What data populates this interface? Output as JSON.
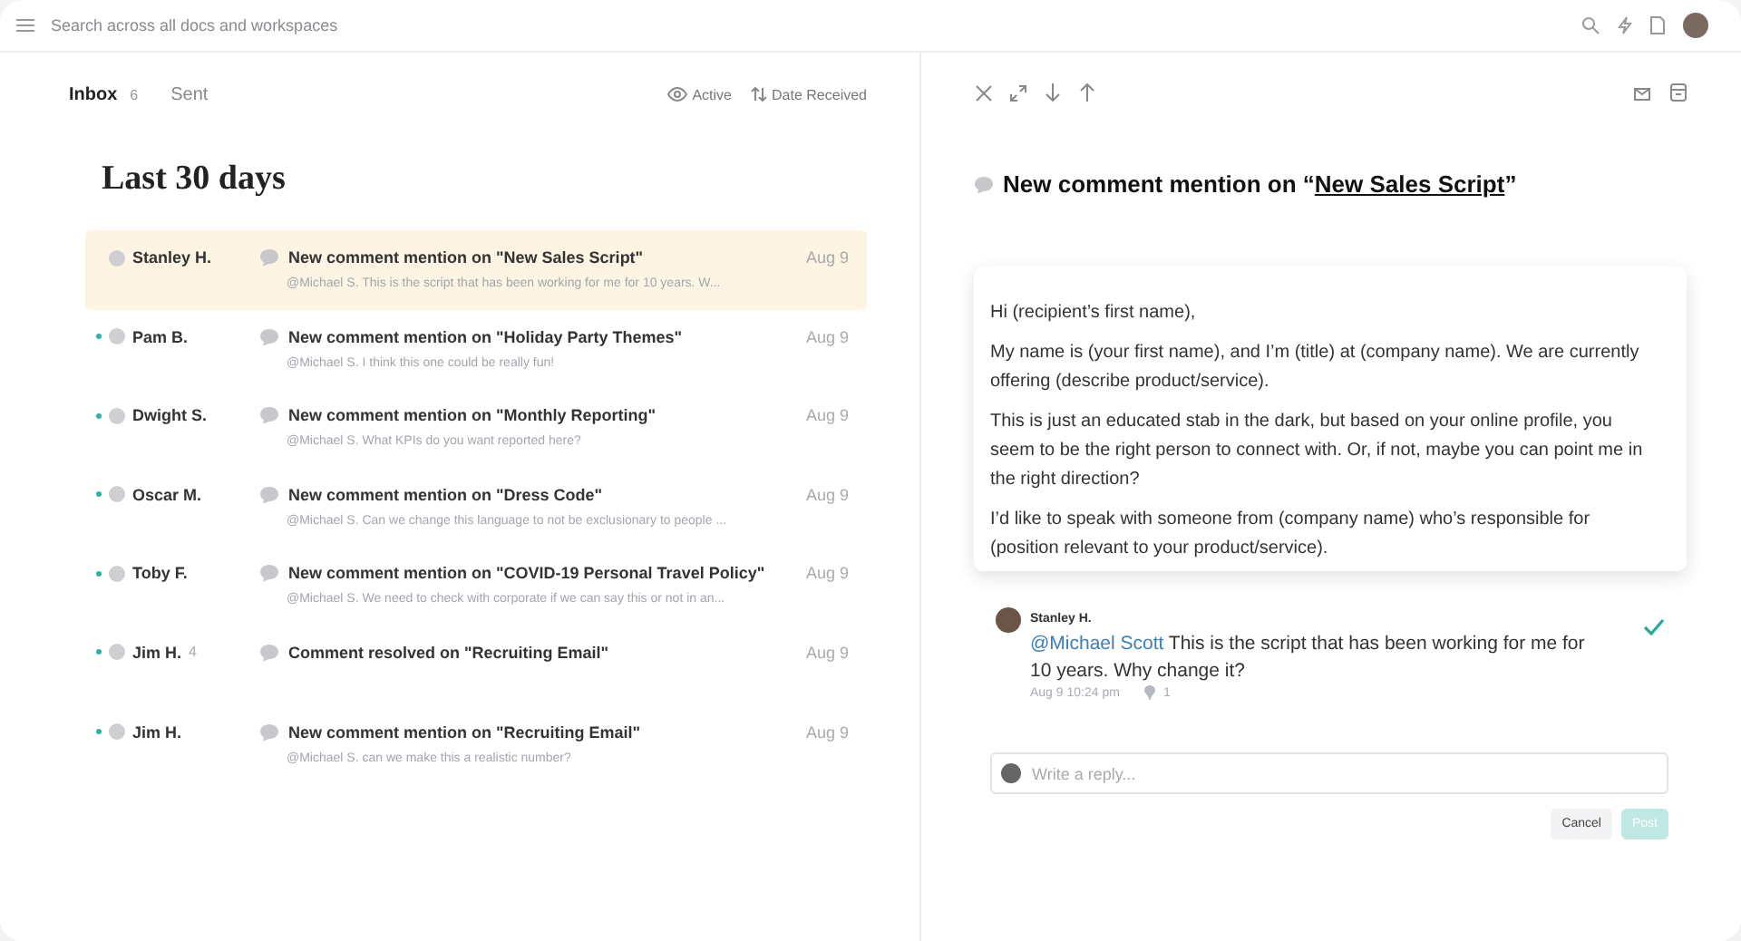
{
  "search": {
    "placeholder": "Search across all docs and workspaces"
  },
  "tabs": [
    {
      "label": "Inbox",
      "count": "6",
      "selected": true
    },
    {
      "label": "Sent",
      "selected": false
    }
  ],
  "filters": [
    {
      "kind": "view",
      "label": "Active"
    },
    {
      "kind": "sort",
      "label": "Date Received"
    }
  ],
  "section_title": "Last 30 days",
  "notifications": [
    {
      "sender": "Stanley H.",
      "unread": false,
      "selected": true,
      "title": "New comment mention on \"New Sales Script\"",
      "preview": "@Michael S. This is the script that has been working for me for 10 years. W...",
      "date": "Aug 9"
    },
    {
      "sender": "Pam B.",
      "unread": true,
      "selected": false,
      "title": "New comment mention on \"Holiday Party Themes\"",
      "preview": "@Michael S. I think this one could be really fun!",
      "date": "Aug 9"
    },
    {
      "sender": "Dwight S.",
      "unread": true,
      "selected": false,
      "title": "New comment mention on \"Monthly Reporting\"",
      "preview": "@Michael S. What KPIs do you want reported here?",
      "date": "Aug 9"
    },
    {
      "sender": "Oscar M.",
      "unread": true,
      "selected": false,
      "title": "New comment mention on \"Dress Code\"",
      "preview": "@Michael S. Can we change this language to not be exclusionary to people ...",
      "date": "Aug 9"
    },
    {
      "sender": "Toby F.",
      "unread": true,
      "selected": false,
      "title": "New comment mention on \"COVID-19 Personal Travel Policy\"",
      "preview": "@Michael S. We need to check with corporate if we can say this or not in an...",
      "date": "Aug 9"
    },
    {
      "sender": "Jim H.",
      "count": "4",
      "unread": true,
      "selected": false,
      "title": "Comment resolved on \"Recruiting Email\"",
      "date": "Aug 9"
    },
    {
      "sender": "Jim H.",
      "unread": true,
      "selected": false,
      "title": "New comment mention on \"Recruiting Email\"",
      "preview": "@Michael S. can we make this a realistic number?",
      "date": "Aug 9"
    }
  ],
  "detail": {
    "title_prefix": "New comment mention on “",
    "doc_link": "New Sales Script",
    "title_suffix": "”",
    "document_paragraphs": [
      "Hi (recipient’s first name),",
      "My name is (your first name), and I’m (title) at (company name). We are currently offering (describe product/service).",
      "This is just an educated stab in the dark, but based on your online profile, you seem to be the right person to connect with. Or, if not, maybe you can point me in the right direction?",
      "I’d like to speak with someone from (company name) who’s responsible for (position relevant to your product/service)."
    ],
    "comment": {
      "author": "Stanley H.",
      "mention": "@Michael Scott",
      "text": " This is the script that has been working for me for 10 years. Why change it?",
      "time": "Aug 9 10:24 pm",
      "pins": "1",
      "resolved": true
    },
    "reply": {
      "placeholder": "Write a reply..."
    },
    "buttons": [
      {
        "label": "Cancel",
        "kind": "secondary"
      },
      {
        "label": "Post",
        "kind": "primary",
        "disabled": true
      }
    ]
  }
}
